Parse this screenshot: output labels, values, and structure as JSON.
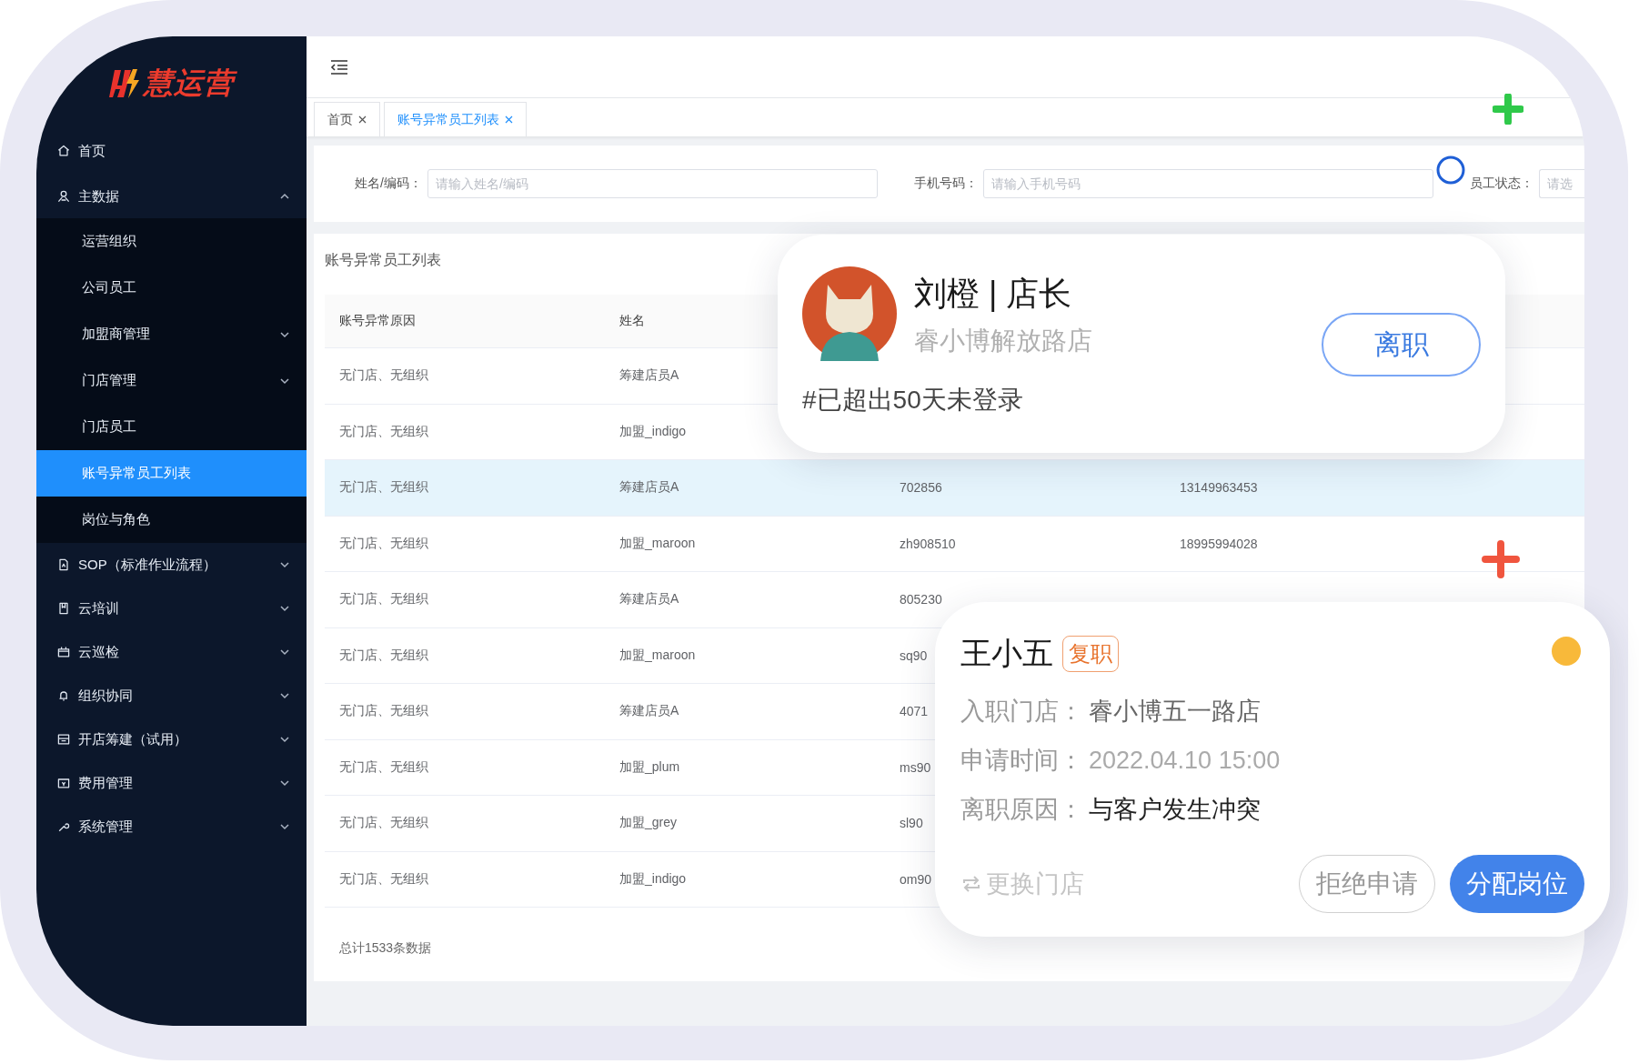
{
  "logo": {
    "text": "慧运营"
  },
  "sidebar": {
    "items": [
      {
        "label": "首页",
        "selected": false
      },
      {
        "label": "主数据",
        "selected": false,
        "expanded": true,
        "children": [
          {
            "label": "运营组织",
            "selected": false
          },
          {
            "label": "公司员工",
            "selected": false
          },
          {
            "label": "加盟商管理",
            "selected": false,
            "expanded": false
          },
          {
            "label": "门店管理",
            "selected": false,
            "expanded": false
          },
          {
            "label": "门店员工",
            "selected": false
          },
          {
            "label": "账号异常员工列表",
            "selected": true
          },
          {
            "label": "岗位与角色",
            "selected": false
          }
        ]
      },
      {
        "label": "SOP（标准作业流程）",
        "selected": false,
        "expanded": false
      },
      {
        "label": "云培训",
        "selected": false,
        "expanded": false
      },
      {
        "label": "云巡检",
        "selected": false,
        "expanded": false
      },
      {
        "label": "组织协同",
        "selected": false,
        "expanded": false
      },
      {
        "label": "开店筹建（试用）",
        "selected": false,
        "expanded": false
      },
      {
        "label": "费用管理",
        "selected": false,
        "expanded": false
      },
      {
        "label": "系统管理",
        "selected": false,
        "expanded": false
      }
    ]
  },
  "tabs": [
    {
      "label": "首页",
      "selected": false
    },
    {
      "label": "账号异常员工列表",
      "selected": true
    }
  ],
  "filters": [
    {
      "label": "姓名/编码：",
      "placeholder": "请输入姓名/编码"
    },
    {
      "label": "手机号码：",
      "placeholder": "请输入手机号码"
    },
    {
      "label": "员工状态：",
      "placeholder": "请选"
    }
  ],
  "table": {
    "title": "账号异常员工列表",
    "columns": [
      "账号异常原因",
      "姓名"
    ],
    "rows": [
      {
        "cells": [
          "无门店、无组织",
          "筹建店员A"
        ],
        "selected": false
      },
      {
        "cells": [
          "无门店、无组织",
          "加盟_indigo"
        ],
        "selected": false
      },
      {
        "cells": [
          "无门店、无组织",
          "筹建店员A",
          "702856",
          "13149963453"
        ],
        "selected": true
      },
      {
        "cells": [
          "无门店、无组织",
          "加盟_maroon",
          "zh908510",
          "18995994028"
        ],
        "selected": false
      },
      {
        "cells": [
          "无门店、无组织",
          "筹建店员A",
          "805230"
        ],
        "selected": false
      },
      {
        "cells": [
          "无门店、无组织",
          "加盟_maroon",
          "sq90"
        ],
        "selected": false
      },
      {
        "cells": [
          "无门店、无组织",
          "筹建店员A",
          "4071"
        ],
        "selected": false
      },
      {
        "cells": [
          "无门店、无组织",
          "加盟_plum",
          "ms90"
        ],
        "selected": false
      },
      {
        "cells": [
          "无门店、无组织",
          "加盟_grey",
          "sl90"
        ],
        "selected": false
      },
      {
        "cells": [
          "无门店、无组织",
          "加盟_indigo",
          "om90"
        ],
        "selected": false
      }
    ],
    "footer": "总计1533条数据"
  },
  "profile_card": {
    "name": "刘橙 | 店长",
    "store": "睿小博解放路店",
    "button": "离职",
    "note": "#已超出50天未登录"
  },
  "request_card": {
    "name": "王小五",
    "badge": "复职",
    "fields": [
      {
        "label": "入职门店：",
        "value": "睿小博五一路店"
      },
      {
        "label": "申请时间：",
        "value": "2022.04.10 15:00"
      },
      {
        "label": "离职原因：",
        "value": "与客户发生冲突"
      }
    ],
    "link": "更换门店",
    "buttons": [
      {
        "label": "拒绝申请",
        "kind": "outline"
      },
      {
        "label": "分配岗位",
        "kind": "primary"
      }
    ]
  }
}
